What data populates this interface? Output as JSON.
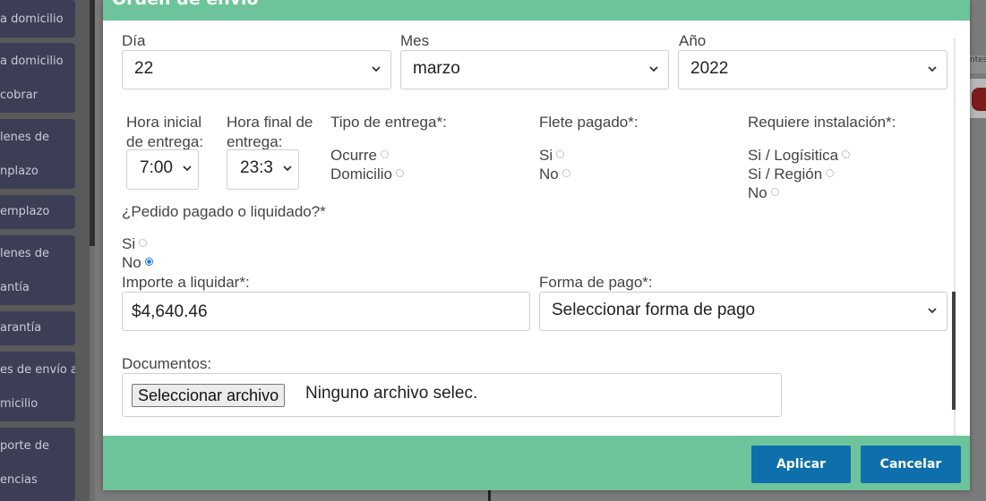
{
  "background": {
    "sidebar_items": [
      "a domicilio",
      "a domicilio",
      "cobrar",
      "lenes de",
      "nplazo",
      "emplazo",
      "lenes de",
      "antía",
      "arantía",
      "es de envío a",
      "micilio",
      "porte de",
      "encias"
    ],
    "right_tag": "ntes"
  },
  "modal": {
    "title": "Orden de envío",
    "date": {
      "day_label": "Día",
      "day_value": "22",
      "month_label": "Mes",
      "month_value": "marzo",
      "year_label": "Año",
      "year_value": "2022"
    },
    "hora_inicial": {
      "label_1": "Hora inicial",
      "label_2": "de entrega:",
      "value": "7:00"
    },
    "hora_final": {
      "label_1": "Hora final de",
      "label_2": "entrega:",
      "value": "23:3"
    },
    "tipo_entrega": {
      "label": "Tipo de entrega*:",
      "options": [
        "Ocurre",
        "Domicilio"
      ]
    },
    "flete_pagado": {
      "label": "Flete pagado*:",
      "options": [
        "Si",
        "No"
      ]
    },
    "requiere_instalacion": {
      "label": "Requiere instalación*:",
      "options": [
        "Si / Logísitica",
        "Si / Región",
        "No"
      ]
    },
    "pedido_pagado": {
      "label": "¿Pedido pagado o liquidado?*",
      "options": [
        "Si",
        "No"
      ],
      "selected": "No"
    },
    "importe": {
      "label": "Importe a liquidar*:",
      "value": "$4,640.46"
    },
    "forma_pago": {
      "label": "Forma de pago*:",
      "value": "Seleccionar forma de pago"
    },
    "documentos": {
      "label": "Documentos:",
      "button": "Seleccionar archivo",
      "status": "Ninguno archivo selec."
    },
    "buttons": {
      "apply": "Aplicar",
      "cancel": "Cancelar"
    }
  },
  "colors": {
    "header_green": "#6ec49a",
    "primary_button": "#0d6fac",
    "sidebar_item": "#3c3e55"
  }
}
